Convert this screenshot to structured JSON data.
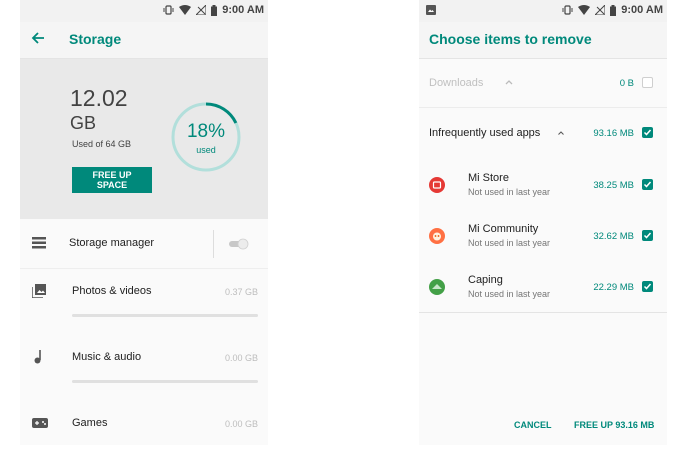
{
  "status_bar": {
    "time": "9:00 AM"
  },
  "left_screen": {
    "title": "Storage",
    "used_value": "12.02",
    "used_unit": "GB",
    "used_of": "Used of 64 GB",
    "free_up_button": "FREE UP SPACE",
    "percent_label": "18%",
    "percent_sub": "used",
    "percent_value": 18,
    "storage_manager_label": "Storage manager",
    "storage_manager_enabled": false,
    "categories": [
      {
        "label": "Photos & videos",
        "size": "0.37 GB",
        "fill_fraction": 0.0
      },
      {
        "label": "Music & audio",
        "size": "0.00 GB",
        "fill_fraction": 0.0
      },
      {
        "label": "Games",
        "size": "0.00 GB",
        "fill_fraction": 0.0
      }
    ]
  },
  "right_screen": {
    "title": "Choose items to remove",
    "downloads": {
      "label": "Downloads",
      "size": "0 B",
      "checked": false
    },
    "infrequent": {
      "label": "Infrequently used apps",
      "size": "93.16 MB",
      "checked": true
    },
    "apps": [
      {
        "name": "Mi Store",
        "sub": "Not used in last year",
        "size": "38.25 MB",
        "checked": true,
        "icon": "mi-store-icon",
        "color": "#e53935"
      },
      {
        "name": "Mi Community",
        "sub": "Not used in last year",
        "size": "32.62 MB",
        "checked": true,
        "icon": "mi-community-icon",
        "color": "#ff7043"
      },
      {
        "name": "Caping",
        "sub": "Not used in last year",
        "size": "22.29 MB",
        "checked": true,
        "icon": "caping-icon",
        "color": "#43a047"
      }
    ],
    "cancel_label": "CANCEL",
    "free_label": "FREE UP 93.16 MB"
  },
  "colors": {
    "accent": "#00897b",
    "background": "#fafafa",
    "summary_bg": "#e9e9e9"
  }
}
